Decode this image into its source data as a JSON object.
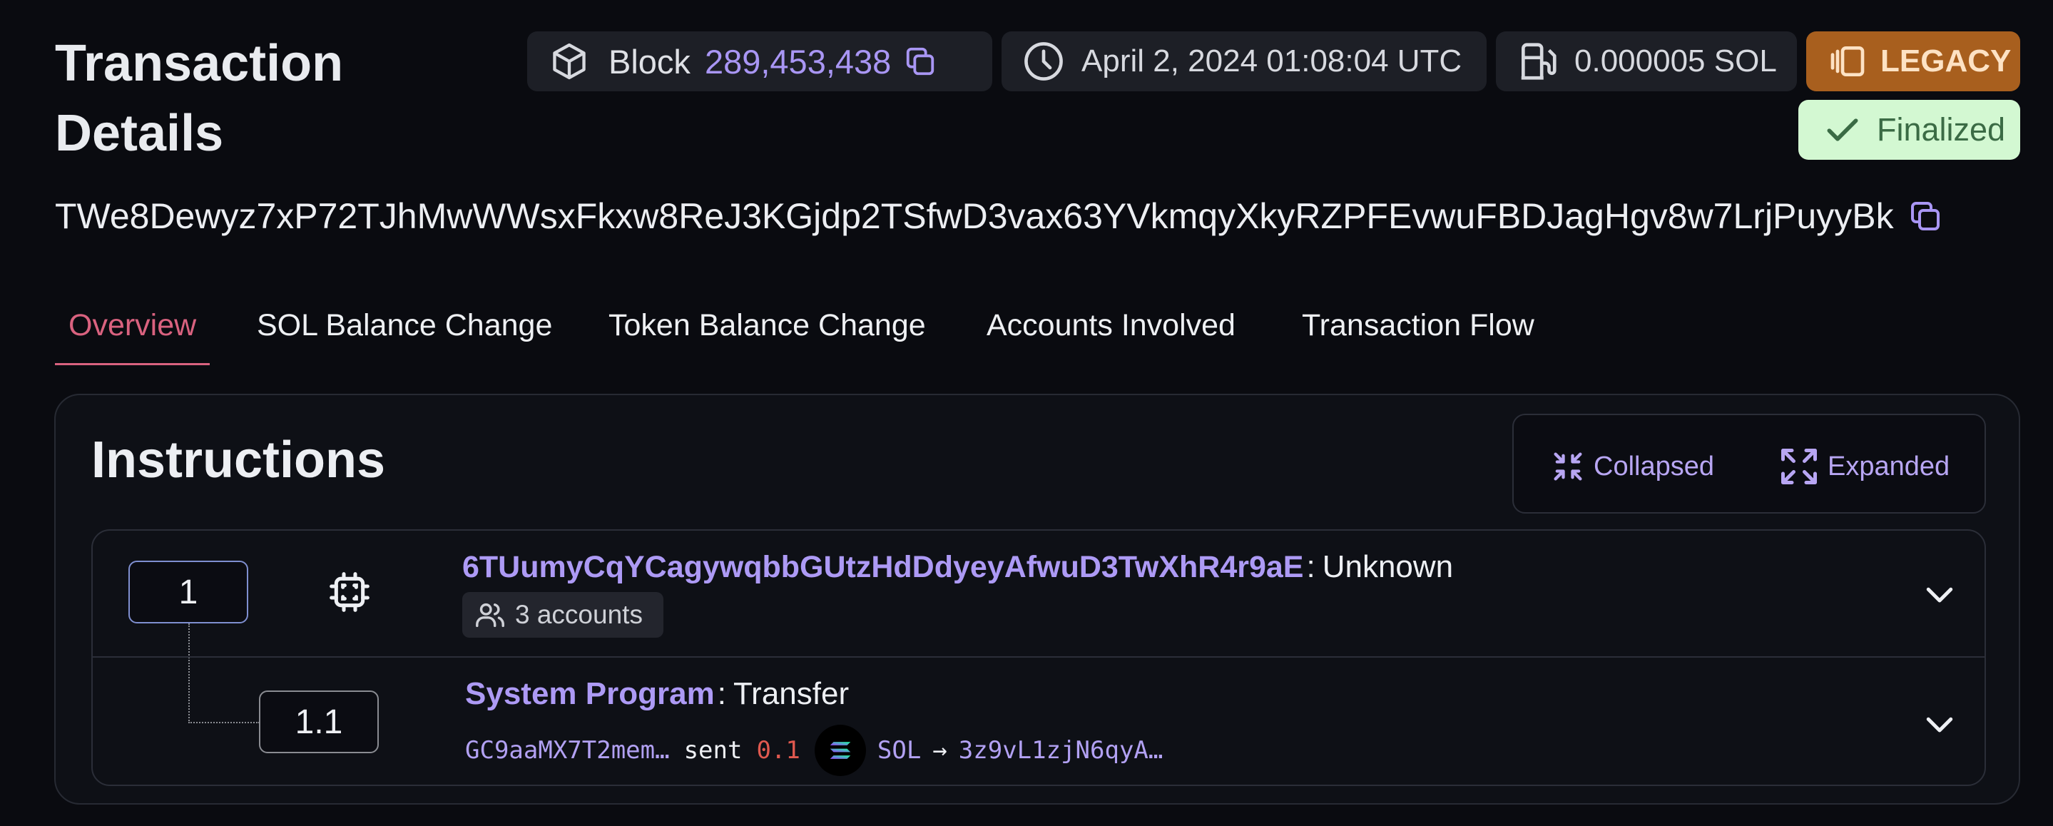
{
  "header": {
    "title": "Transaction Details",
    "block_label": "Block",
    "block_number": "289,453,438",
    "timestamp": "April 2, 2024 01:08:04 UTC",
    "fee": "0.000005 SOL",
    "version_badge": "LEGACY",
    "status_badge": "Finalized",
    "signature": "TWe8Dewyz7xP72TJhMwWWsxFkxw8ReJ3KGjdp2TSfwD3vax63YVkmqyXkyRZPFEvwuFBDJagHgv8w7LrjPuyyBk"
  },
  "tabs": [
    {
      "label": "Overview",
      "active": true
    },
    {
      "label": "SOL Balance Change",
      "active": false
    },
    {
      "label": "Token Balance Change",
      "active": false
    },
    {
      "label": "Accounts Involved",
      "active": false
    },
    {
      "label": "Transaction Flow",
      "active": false
    }
  ],
  "instructions": {
    "title": "Instructions",
    "view_collapsed": "Collapsed",
    "view_expanded": "Expanded",
    "items": [
      {
        "index": "1",
        "program": "6TUumyCqYCagywqbbGUtzHdDdyeyAfwuD3TwXhR4r9aE",
        "separator": ":",
        "type": "Unknown",
        "accounts": "3 accounts",
        "icon": "cpu-chip-icon"
      },
      {
        "index": "1.1",
        "program": "System Program",
        "separator": ":",
        "type": "Transfer",
        "from": "GC9aaMX7T2mem…",
        "verb": "sent",
        "amount": "0.1",
        "token": "SOL",
        "arrow": "→",
        "to": "3z9vL1zjN6qyA…",
        "token_icon": "solana-icon"
      }
    ]
  },
  "colors": {
    "background": "#0a0b10",
    "accent_purple": "#ad9af5",
    "active_tab": "#d9627f",
    "legacy_badge": "#a85f1e",
    "finalized_badge": "#d3f8d2",
    "amount_red": "#e0594f"
  }
}
